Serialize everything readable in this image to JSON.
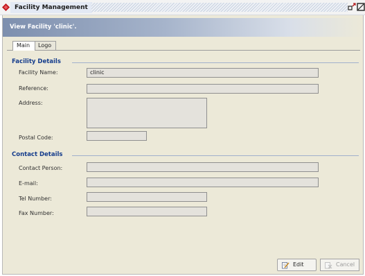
{
  "window": {
    "title": "Facility Management"
  },
  "banner": {
    "text": "View Facility 'clinic'."
  },
  "tabs": [
    {
      "label": "Main"
    },
    {
      "label": "Logo"
    }
  ],
  "facility_details": {
    "heading": "Facility Details",
    "fields": {
      "facility_name": {
        "label": "Facility Name:",
        "value": "clinic"
      },
      "reference": {
        "label": "Reference:",
        "value": ""
      },
      "address": {
        "label": "Address:",
        "value": ""
      },
      "postal_code": {
        "label": "Postal Code:",
        "value": ""
      }
    }
  },
  "contact_details": {
    "heading": "Contact Details",
    "fields": {
      "contact_person": {
        "label": "Contact Person:",
        "value": ""
      },
      "email": {
        "label": "E-mail:",
        "value": ""
      },
      "tel_number": {
        "label": "Tel Number:",
        "value": ""
      },
      "fax_number": {
        "label": "Fax Number:",
        "value": ""
      }
    }
  },
  "buttons": {
    "edit": "Edit",
    "cancel": "Cancel"
  },
  "icons": {
    "app": "red-diamond-icon",
    "restore": "restore-window-icon",
    "maximize": "maximize-window-icon",
    "edit": "edit-icon",
    "cancel": "cancel-icon"
  },
  "colors": {
    "section_heading": "#143c8c",
    "banner_start": "#7d8fae",
    "panel_background": "#ece9d8"
  }
}
